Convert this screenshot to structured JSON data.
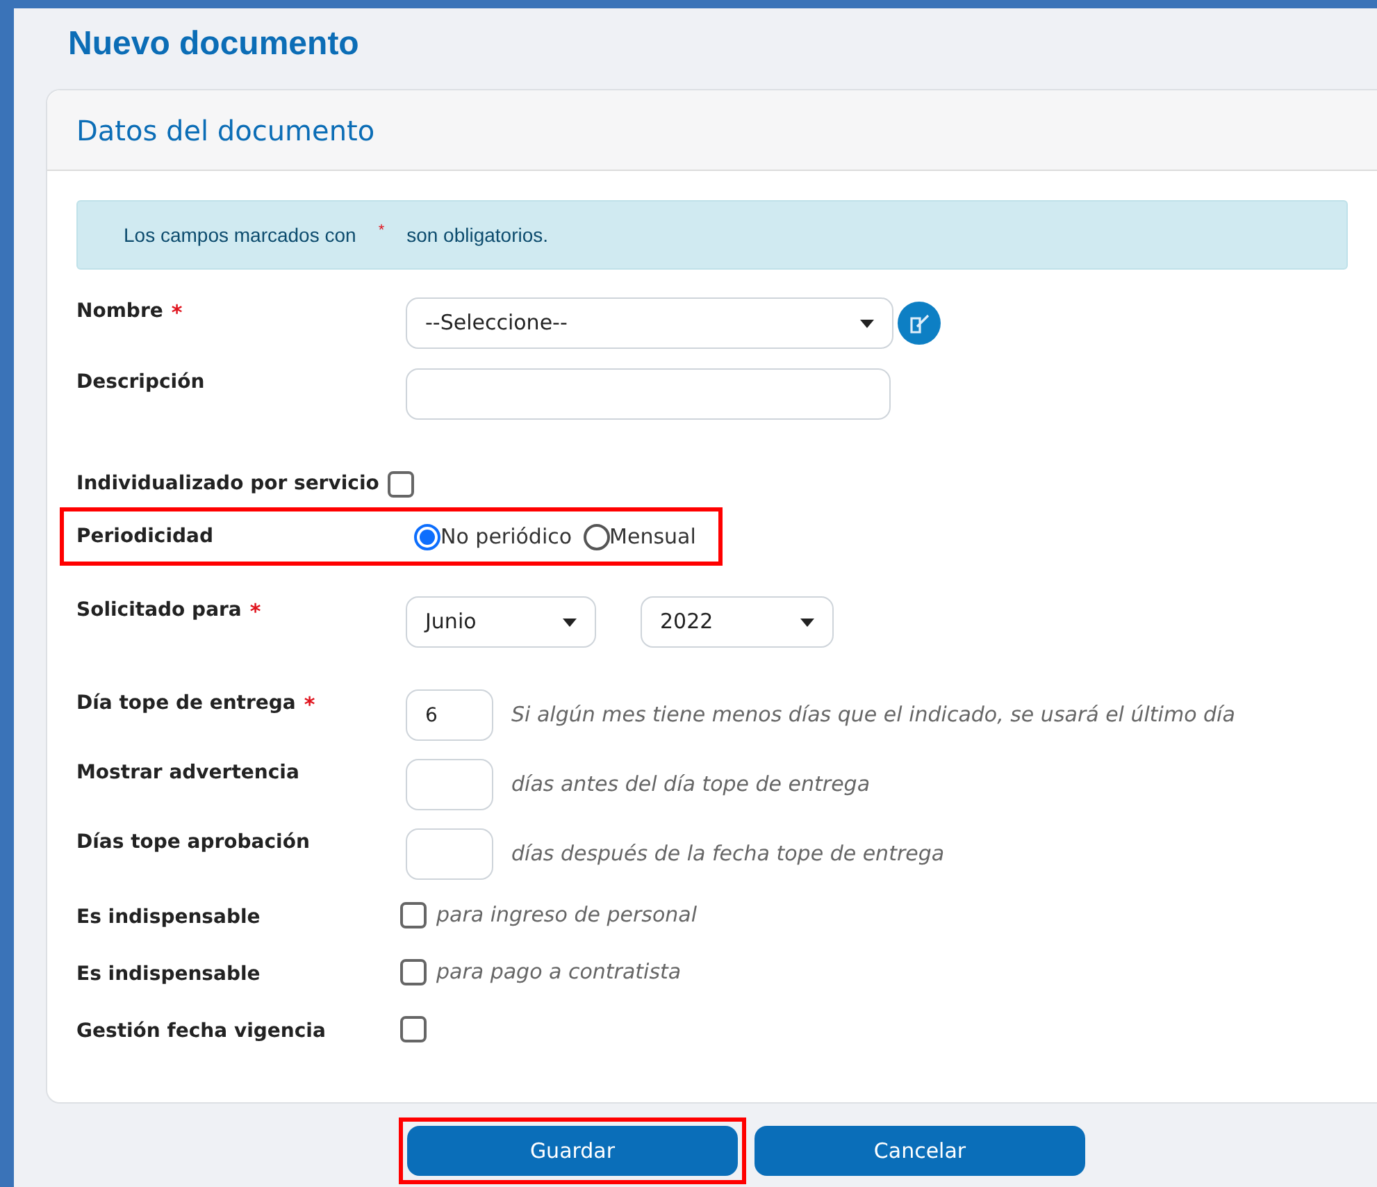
{
  "page_title": "Nuevo documento",
  "card_title": "Datos del documento",
  "notice": {
    "before": "Los campos marcados con",
    "mark": "*",
    "after": "son obligatorios."
  },
  "fields": [
    {
      "kind": "select",
      "label": "Nombre",
      "required": true,
      "value": "--Seleccione--",
      "edit_button": true
    },
    {
      "kind": "text",
      "label": "Descripción",
      "required": false
    },
    {
      "kind": "checkbox_inline",
      "label": "Individualizado por servicio",
      "required": false,
      "checked": false
    },
    {
      "kind": "radio",
      "label": "Periodicidad",
      "required": false,
      "highlighted": true,
      "options": [
        {
          "label": "No periódico",
          "selected": true
        },
        {
          "label": "Mensual",
          "selected": false
        }
      ]
    },
    {
      "kind": "month_year",
      "label": "Solicitado para",
      "required": true,
      "month": "Junio",
      "year": "2022"
    },
    {
      "kind": "number",
      "label": "Día tope de entrega",
      "required": true,
      "value": "6",
      "note": "Si algún mes tiene menos días que el indicado, se usará el último día"
    },
    {
      "kind": "number",
      "label": "Mostrar advertencia",
      "required": false,
      "note": "días antes del día tope de entrega"
    },
    {
      "kind": "number",
      "label": "Días tope aprobación",
      "required": false,
      "note": "días después de la fecha tope de entrega"
    },
    {
      "kind": "checkbox",
      "label": "Es indispensable",
      "required": false,
      "checked": false,
      "note": "para ingreso de personal"
    },
    {
      "kind": "checkbox",
      "label": "Es indispensable",
      "required": false,
      "checked": false,
      "note": "para pago a contratista"
    },
    {
      "kind": "checkbox",
      "label": "Gestión fecha vigencia",
      "required": false,
      "checked": false
    }
  ],
  "buttons": [
    {
      "label": "Guardar",
      "highlighted": true
    },
    {
      "label": "Cancelar",
      "highlighted": false
    }
  ]
}
